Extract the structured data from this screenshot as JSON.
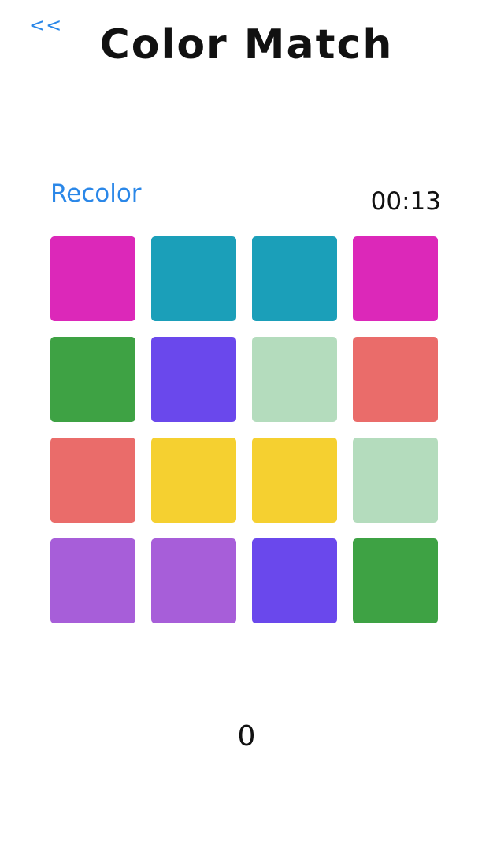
{
  "header": {
    "back_label": "<<",
    "title": "Color Match"
  },
  "controls": {
    "recolor_label": "Recolor",
    "timer": "00:13"
  },
  "board": {
    "rows": 4,
    "columns": 4,
    "tiles": [
      {
        "color": "#dc28b9"
      },
      {
        "color": "#1b9fb9"
      },
      {
        "color": "#1b9fb9"
      },
      {
        "color": "#dc28b9"
      },
      {
        "color": "#3ea244"
      },
      {
        "color": "#6a48ec"
      },
      {
        "color": "#b4dcbd"
      },
      {
        "color": "#ea6c6a"
      },
      {
        "color": "#ea6c6a"
      },
      {
        "color": "#f5d030"
      },
      {
        "color": "#f5d030"
      },
      {
        "color": "#b4dcbd"
      },
      {
        "color": "#a75ed9"
      },
      {
        "color": "#a75ed9"
      },
      {
        "color": "#6a48ec"
      },
      {
        "color": "#3ea244"
      }
    ]
  },
  "score": "0",
  "colors": {
    "accent": "#2a87e8",
    "text": "#111111",
    "background": "#ffffff"
  }
}
